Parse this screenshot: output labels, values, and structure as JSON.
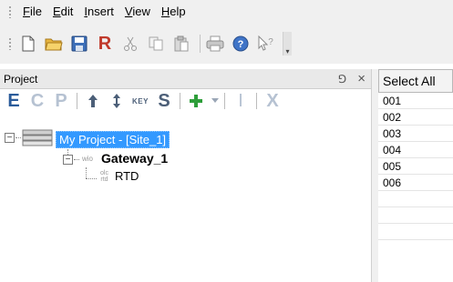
{
  "menu": {
    "items": [
      {
        "label": "File",
        "mnemonic": "F",
        "rest": "ile"
      },
      {
        "label": "Edit",
        "mnemonic": "E",
        "rest": "dit"
      },
      {
        "label": "Insert",
        "mnemonic": "I",
        "rest": "nsert"
      },
      {
        "label": "View",
        "mnemonic": "V",
        "rest": "iew"
      },
      {
        "label": "Help",
        "mnemonic": "H",
        "rest": "elp"
      }
    ]
  },
  "toolbar": {
    "icons": [
      "new-file-icon",
      "open-folder-icon",
      "save-icon",
      "report-icon",
      "cut-icon",
      "copy-icon",
      "paste-icon",
      "print-icon",
      "help-icon",
      "context-help-icon",
      "toolbar-overflow-icon"
    ],
    "report_letter": "R"
  },
  "project_panel": {
    "title": "Project",
    "pin_glyph": "⅁",
    "close_glyph": "×",
    "toolbar": {
      "e": "E",
      "c": "C",
      "p": "P",
      "key": "KEY",
      "s": "S",
      "x": "X",
      "i": "I"
    },
    "tree": {
      "root_label": "My Project - [Site_1]",
      "gateway_tag": "wio",
      "gateway_label": "Gateway_1",
      "rtd_tag_top": "olc",
      "rtd_tag_bottom": "rtd",
      "rtd_label": "RTD",
      "expander_glyph": "−"
    }
  },
  "grid": {
    "select_all": "Select All",
    "rows": [
      "001",
      "002",
      "003",
      "004",
      "005",
      "006"
    ]
  },
  "colors": {
    "selection": "#3399ff",
    "accent_blue": "#2a5b9a",
    "accent_red": "#c0392b",
    "accent_green": "#2e9e3a"
  }
}
